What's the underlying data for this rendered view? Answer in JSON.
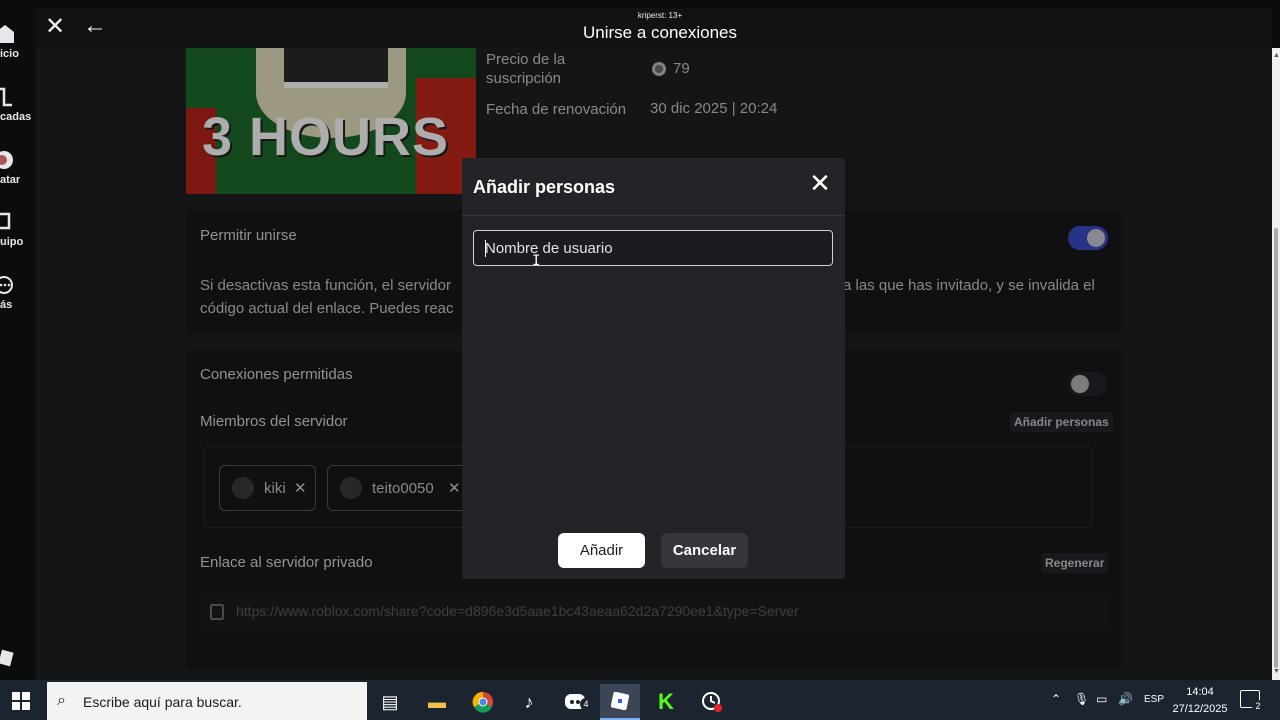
{
  "sidebar": {
    "items": [
      {
        "label": "icio",
        "icon": "home-icon"
      },
      {
        "label": "cadas",
        "icon": "charts-icon"
      },
      {
        "label": "atar",
        "icon": "avatar-icon"
      },
      {
        "label": "uipo",
        "icon": "inventory-icon"
      },
      {
        "label": "ás",
        "icon": "more-icon"
      }
    ]
  },
  "topbar": {
    "tiny_label": "kriperst: 13+",
    "title": "Unirse a conexiones"
  },
  "subscription": {
    "thumbnail_text": "3 HOURS",
    "price_label": "Precio de la suscripción",
    "price_value": "79",
    "renewal_label": "Fecha de renovación",
    "renewal_value": "30 dic 2025 | 20:24"
  },
  "allow_join": {
    "title": "Permitir unirse",
    "enabled": true,
    "desc_left": "Si desactivas esta función, el servidor",
    "desc_right": "a las que has invitado, y se invalida el",
    "desc_line2": "código actual del enlace. Puedes reac"
  },
  "connections": {
    "allowed_label": "Conexiones permitidas",
    "allowed_enabled": false,
    "members_label": "Miembros del servidor",
    "add_people_link": "Añadir personas",
    "members": [
      {
        "name": "kiki"
      },
      {
        "name": "teito0050"
      }
    ],
    "private_link_label": "Enlace al servidor privado",
    "regenerate_label": "Regenerar",
    "link_url": "https://www.roblox.com/share?code=d896e3d5aae1bc43aeaa62d2a7290ee1&type=Server"
  },
  "modal": {
    "title": "Añadir personas",
    "input_placeholder": "Nombre de usuario",
    "input_value": "",
    "add_button": "Añadir",
    "cancel_button": "Cancelar"
  },
  "taskbar": {
    "search_placeholder": "Escribe aquí para buscar.",
    "apps": [
      "task-view-icon",
      "file-explorer-icon",
      "chrome-icon",
      "tiktok-icon",
      "discord-icon",
      "roblox-icon",
      "kick-icon",
      "clock-app-icon"
    ],
    "discord_badge": "4",
    "language": "ESP",
    "time": "14:04",
    "date": "27/12/2025",
    "notification_count": "2"
  },
  "colors": {
    "toggle_on": "#3a4cc7",
    "modal_bg": "#232427",
    "taskbar_bg": "#1c2430"
  }
}
